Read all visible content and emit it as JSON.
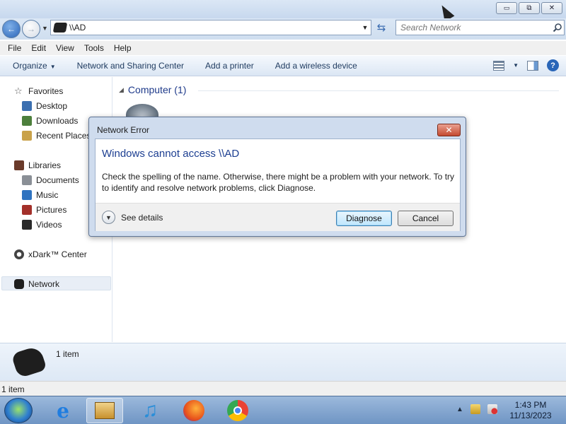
{
  "window": {
    "minimize_glyph": "▭",
    "maximize_glyph": "⧉",
    "close_glyph": "✕"
  },
  "address": {
    "path": "\\\\AD",
    "search_placeholder": "Search Network"
  },
  "menu": [
    "File",
    "Edit",
    "View",
    "Tools",
    "Help"
  ],
  "commands": {
    "organize": "Organize",
    "network_sharing": "Network and Sharing Center",
    "add_printer": "Add a printer",
    "add_wireless": "Add a wireless device"
  },
  "sidebar": {
    "favorites": "Favorites",
    "desktop": "Desktop",
    "downloads": "Downloads",
    "recent": "Recent Places",
    "libraries": "Libraries",
    "documents": "Documents",
    "music": "Music",
    "pictures": "Pictures",
    "videos": "Videos",
    "xdark": "xDark™ Center",
    "network": "Network"
  },
  "content": {
    "group_label": "Computer (1)"
  },
  "details_pane": {
    "count": "1 item"
  },
  "status": {
    "count": "1 item"
  },
  "dialog": {
    "title": "Network Error",
    "heading": "Windows cannot access \\\\AD",
    "message": "Check the spelling of the name. Otherwise, there might be a problem with your network. To try to identify and resolve network problems, click Diagnose.",
    "see_details": "See details",
    "diagnose": "Diagnose",
    "cancel": "Cancel"
  },
  "taskbar": {
    "time": "1:43 PM",
    "date": "11/13/2023"
  },
  "colors": {
    "dialog_heading": "#1c3e91",
    "command_text": "#1e3a5f",
    "taskbar": "#6f95c4"
  }
}
